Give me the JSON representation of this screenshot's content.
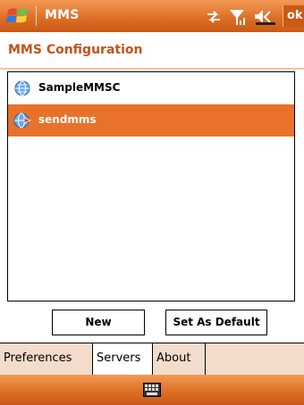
{
  "titlebar": {
    "app_title": "MMS",
    "ok_label": "ok"
  },
  "header": {
    "page_title": "MMS Configuration"
  },
  "list": {
    "items": [
      {
        "label": "SampleMMSC",
        "icon": "globe-icon",
        "selected": false
      },
      {
        "label": "sendmms",
        "icon": "globe-arrow-icon",
        "selected": true
      }
    ]
  },
  "buttons": {
    "new_label": "New",
    "default_label": "Set As Default"
  },
  "tabs": [
    {
      "label": "Preferences",
      "active": false
    },
    {
      "label": "Servers",
      "active": true
    },
    {
      "label": "About",
      "active": false
    }
  ],
  "colors": {
    "accent": "#e8722a",
    "title_text": "#c2521a",
    "tab_background": "#f3dccb"
  }
}
